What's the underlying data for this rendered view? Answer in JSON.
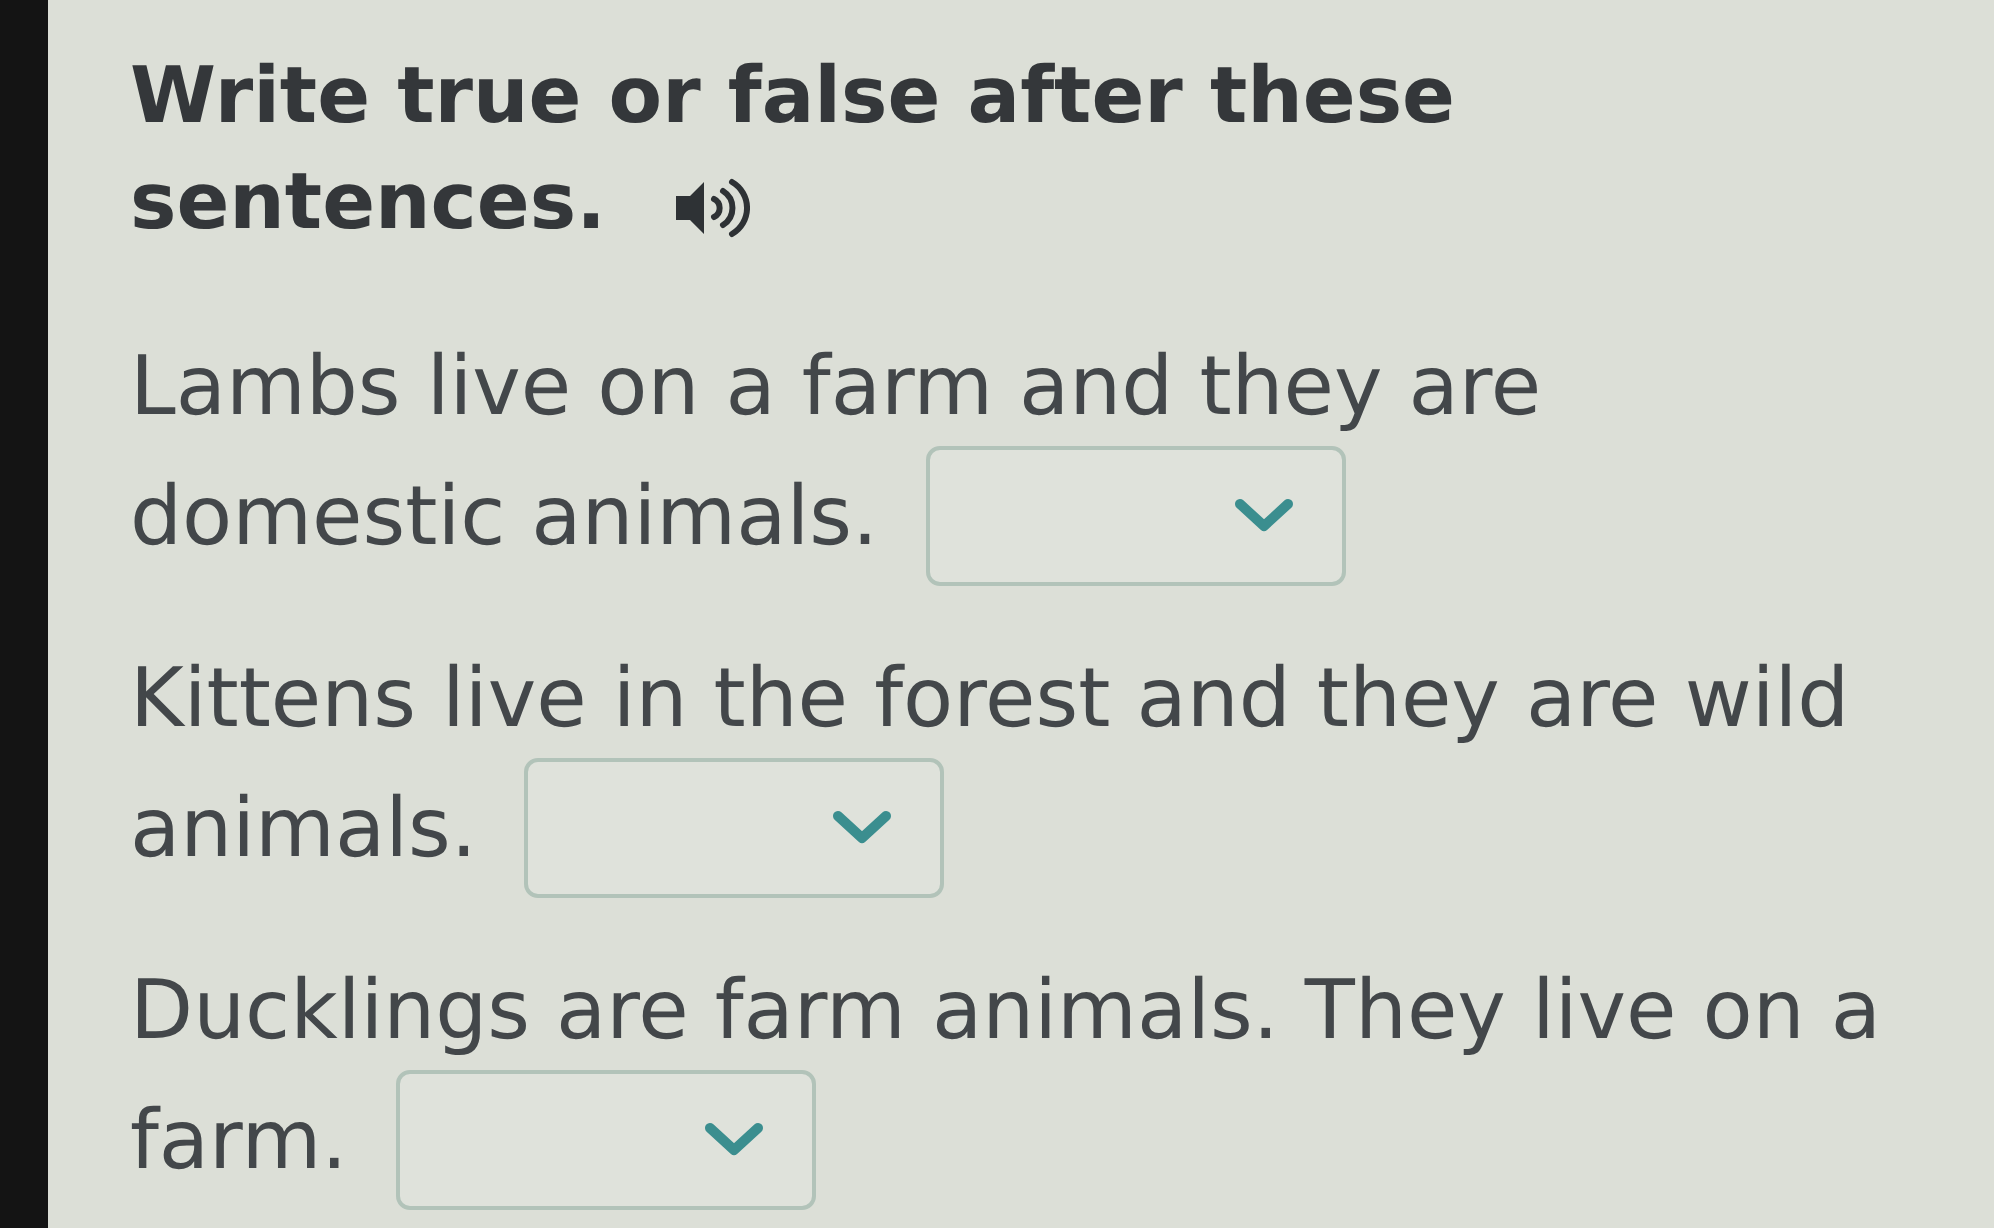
{
  "instruction": {
    "lines": [
      "Write true or false after these",
      "sentences."
    ]
  },
  "sentences": [
    {
      "lines": [
        "Lambs live on a farm and they are",
        "domestic animals."
      ]
    },
    {
      "lines": [
        "Kittens live in the forest and they are wild",
        "animals."
      ]
    },
    {
      "lines": [
        "Ducklings are farm animals. They live on a",
        "farm."
      ]
    }
  ]
}
